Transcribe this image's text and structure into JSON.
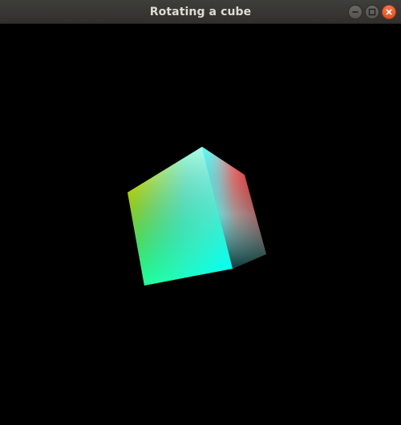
{
  "window": {
    "title": "Rotating a cube"
  },
  "controls": {
    "minimize_icon": "minimize-icon",
    "maximize_icon": "maximize-icon",
    "close_icon": "close-icon"
  },
  "colors": {
    "background": "#000000",
    "titlebar": "#3a3935",
    "title_text": "#dfdbd2",
    "close_button": "#e9602c"
  },
  "scene": {
    "object": "cube",
    "vertex_colors": [
      "#ffff00",
      "#ffffff",
      "#ff0000",
      "#00ffff",
      "#00ff44"
    ]
  }
}
